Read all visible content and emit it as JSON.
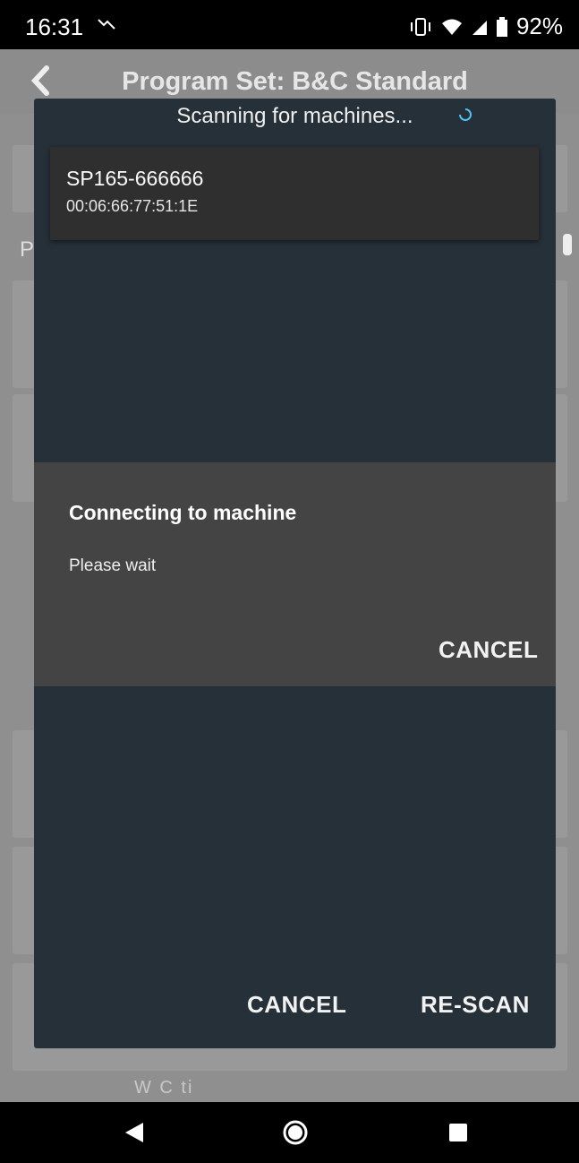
{
  "status_bar": {
    "time": "16:31",
    "trend_icon": "trending-icon",
    "battery": "92%",
    "icons": [
      "vibrate-icon",
      "wifi-icon",
      "signal-icon",
      "battery-icon"
    ]
  },
  "app_bar": {
    "title": "Program Set: B&C Standard",
    "back_icon": "back-chevron-icon"
  },
  "background": {
    "row_letter": "P",
    "bottom_text": "W     C  ti"
  },
  "scan_dialog": {
    "header": "Scanning for machines...",
    "spinner_icon": "loading-spinner-icon",
    "devices": [
      {
        "name": "SP165-666666",
        "mac": "00:06:66:77:51:1E"
      }
    ],
    "cancel_label": "CANCEL",
    "rescan_label": "RE-SCAN"
  },
  "connect_dialog": {
    "title": "Connecting to machine",
    "message": "Please wait",
    "cancel_label": "CANCEL"
  },
  "nav_bar": {
    "icons": [
      "back-triangle-icon",
      "home-circle-icon",
      "recents-square-icon"
    ]
  },
  "colors": {
    "dialog_bg": "#263038",
    "progress_bg": "#444444",
    "accent_spinner": "#4fc3f7"
  }
}
